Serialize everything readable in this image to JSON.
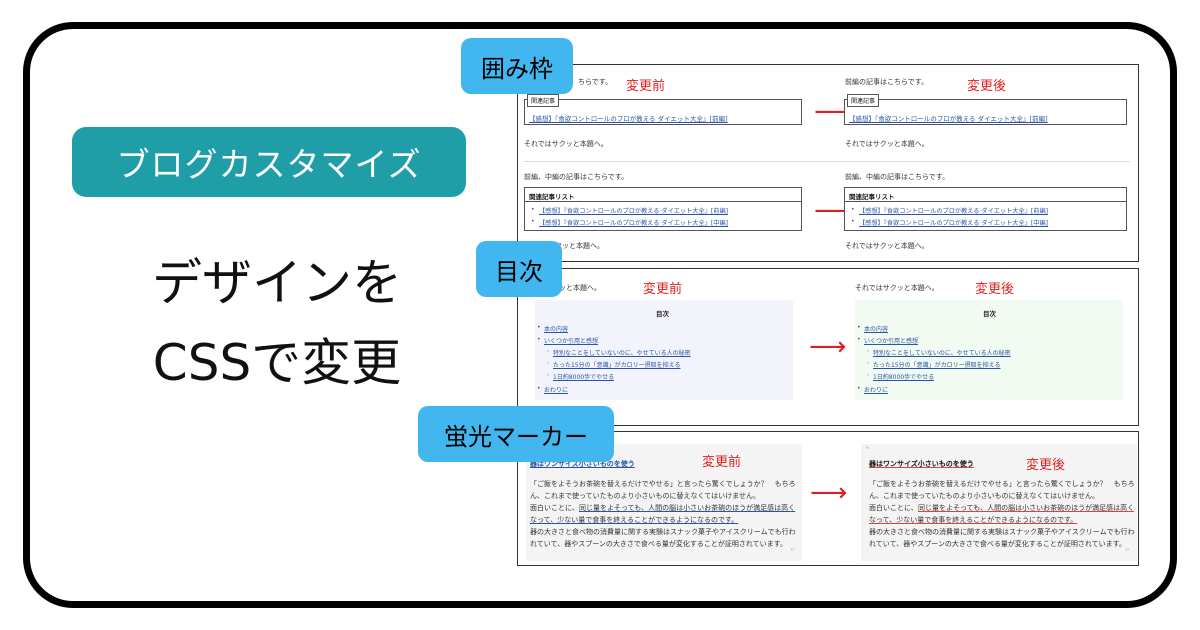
{
  "left": {
    "category": "ブログカスタマイズ",
    "headline_line1": "デザインを",
    "headline_line2": "CSSで変更"
  },
  "tags": {
    "frame": "囲み枠",
    "toc": "目次",
    "marker": "蛍光マーカー"
  },
  "labels": {
    "before": "変更前",
    "after": "変更後"
  },
  "frame_panel": {
    "intro_before": "ちらです。",
    "intro_after": "前編の記事はこちらです。",
    "related_label": "関連記事",
    "related_link": "【感想】『食欲コントロールのプロが教える ダイエット大全』[前編]",
    "continue_text": "それではサクッと本題へ。",
    "intro2": "前編、中編の記事はこちらです。",
    "list_title": "関連記事リスト",
    "list_items": [
      "【感想】『食欲コントロールのプロが教える ダイエット大全』[前編]",
      "【感想】『食欲コントロールのプロが教える ダイエット大全』[中編]"
    ],
    "continue_partial": "サクッと本題へ。"
  },
  "toc_panel": {
    "lead_before": "クッと本題へ。",
    "lead_after": "それではサクッと本題へ。",
    "title": "目次",
    "items": [
      "本の内容",
      "いくつか引用と感想",
      "特別なことをしていないのに、やせている人の秘密",
      "たった15分の「意識」がカロリー摂取を抑える",
      "1日約8000歩でやせる",
      "おわりに"
    ]
  },
  "marker_panel": {
    "heading": "器はワンサイズ小さいものを使う",
    "lines": [
      "「ご飯をよそうお茶碗を替えるだけでやせる」と言ったら驚くでしょうか？　もちろ",
      "ん、これまで使っていたものより小さいものに替えなくてはいけません。",
      "面白いことに、",
      "同じ量をよそっても、人間の脳は小さいお茶碗のほうが満足感は高く",
      "なって、少ない量で食事を終えることができるようになるのです。",
      "器の大きさと食べ物の消費量に関する実験はスナック菓子やアイスクリームでも行わ",
      "れていて、器やスプーンの大きさで食べる量が変化することが証明されています。"
    ]
  },
  "colors": {
    "accent": "#1f9ea7",
    "tag": "#42b6ef",
    "label_red": "#e02020",
    "link": "#2a55a5"
  }
}
